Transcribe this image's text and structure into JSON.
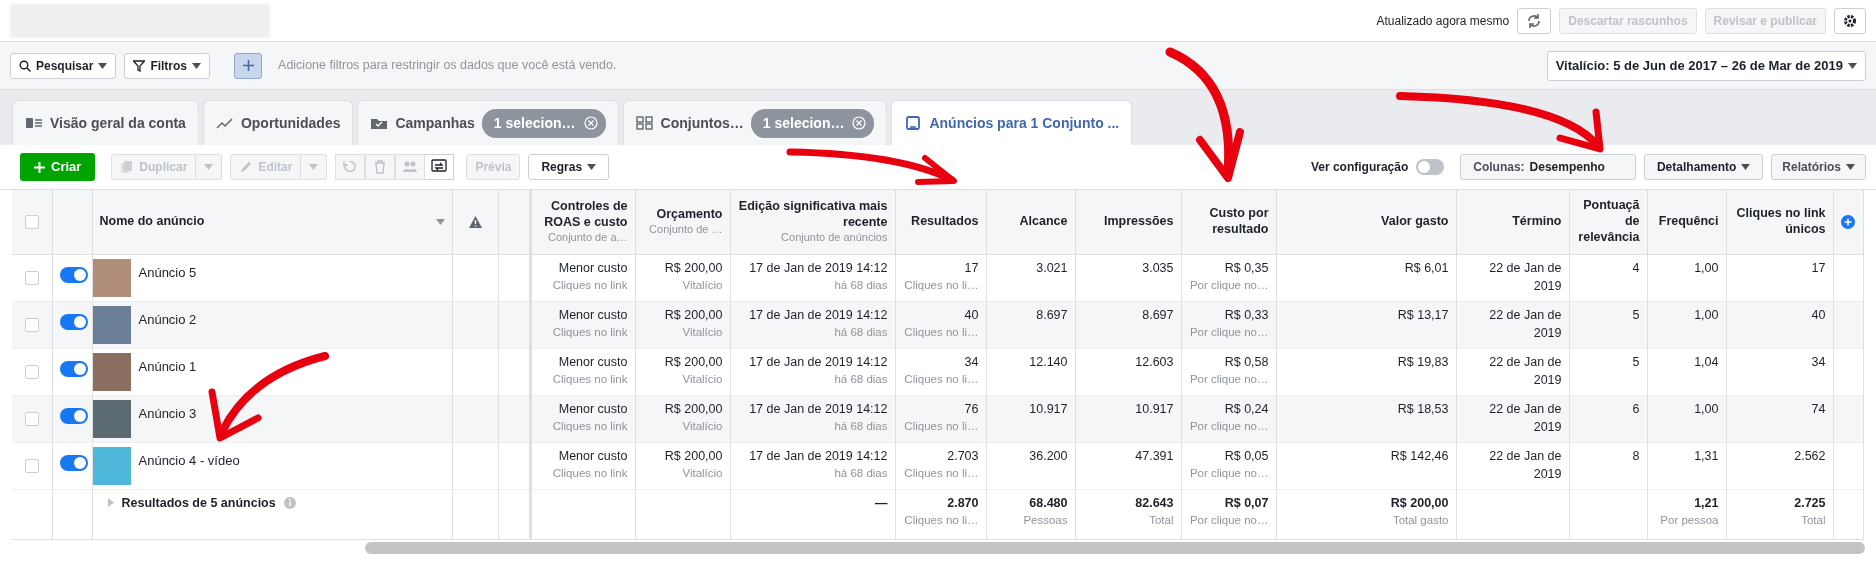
{
  "top_bar": {
    "status": "Atualizado agora mesmo",
    "buttons": [
      {
        "label": "Descartar rascunhos",
        "disabled": true
      },
      {
        "label": "Revisar e publicar",
        "disabled": true
      }
    ]
  },
  "filter_bar": {
    "search": "Pesquisar",
    "filters": "Filtros",
    "hint": "Adicione filtros para restringir os dados que você está vendo.",
    "date_range": "Vitalício: 5 de Jun de 2017 – 26 de Mar de 2019"
  },
  "tabs": [
    {
      "label": "Visão geral da conta",
      "selected": false
    },
    {
      "label": "Oportunidades",
      "selected": false
    },
    {
      "label": "Campanhas",
      "badge": "1 selecion…",
      "selected": false
    },
    {
      "label": "Conjuntos…",
      "badge": "1 selecion…",
      "selected": false
    },
    {
      "label": "Anúncios para 1 Conjunto ...",
      "selected": true
    }
  ],
  "toolbar": {
    "actions": [
      {
        "kind": "primary",
        "label": "Criar",
        "disabled": false
      },
      {
        "kind": "split",
        "label": "Duplicar",
        "disabled": true
      },
      {
        "kind": "split",
        "label": "Editar",
        "disabled": true
      },
      {
        "kind": "icon",
        "disabled": true
      },
      {
        "kind": "icon",
        "disabled": true
      },
      {
        "kind": "icon",
        "disabled": true
      },
      {
        "kind": "icon",
        "disabled": false
      },
      {
        "kind": "plain",
        "label": "Prévia",
        "disabled": true
      },
      {
        "kind": "dropdown",
        "label": "Regras",
        "disabled": false
      }
    ],
    "view_settings": {
      "label": "Ver configuração",
      "on": false
    },
    "columns_picker": {
      "label": "Colunas:",
      "value": "Desempenho"
    },
    "breakdown": "Detalhamento",
    "reports": "Relatórios"
  },
  "table": {
    "all_selected": false,
    "name_column": "Nome do anúncio",
    "columns": [
      {
        "label": "Controles de ROAS e custo",
        "sublabel": "Conjunto de a…"
      },
      {
        "label": "Orçamento",
        "sublabel": "Conjunto de …"
      },
      {
        "label": "Edição significativa mais recente",
        "sublabel": "Conjunto de anúncios"
      },
      {
        "label": "Resultados"
      },
      {
        "label": "Alcance"
      },
      {
        "label": "Impressões"
      },
      {
        "label": "Custo por resultado"
      },
      {
        "label": "Valor gasto"
      },
      {
        "label": "Término"
      },
      {
        "label": "Pontuaçã de relevância"
      },
      {
        "label": "Frequênci"
      },
      {
        "label": "Cliques no link únicos"
      }
    ],
    "rows": [
      {
        "selected": false,
        "on": true,
        "name": "Anúncio 5",
        "cells": [
          [
            "Menor custo",
            "Cliques no link"
          ],
          [
            "R$ 200,00",
            "Vitalício"
          ],
          [
            "17 de Jan de 2019 14:12",
            "há 68 dias"
          ],
          [
            "17",
            "Cliques no li…"
          ],
          [
            "3.021"
          ],
          [
            "3.035"
          ],
          [
            "R$ 0,35",
            "Por clique no…"
          ],
          [
            "R$ 6,01"
          ],
          [
            "22 de Jan de 2019"
          ],
          [
            "4"
          ],
          [
            "1,00"
          ],
          [
            "17"
          ]
        ]
      },
      {
        "selected": false,
        "on": true,
        "name": "Anúncio 2",
        "cells": [
          [
            "Menor custo",
            "Cliques no link"
          ],
          [
            "R$ 200,00",
            "Vitalício"
          ],
          [
            "17 de Jan de 2019 14:12",
            "há 68 dias"
          ],
          [
            "40",
            "Cliques no li…"
          ],
          [
            "8.697"
          ],
          [
            "8.697"
          ],
          [
            "R$ 0,33",
            "Por clique no…"
          ],
          [
            "R$ 13,17"
          ],
          [
            "22 de Jan de 2019"
          ],
          [
            "5"
          ],
          [
            "1,00"
          ],
          [
            "40"
          ]
        ]
      },
      {
        "selected": false,
        "on": true,
        "name": "Anúncio 1",
        "cells": [
          [
            "Menor custo",
            "Cliques no link"
          ],
          [
            "R$ 200,00",
            "Vitalício"
          ],
          [
            "17 de Jan de 2019 14:12",
            "há 68 dias"
          ],
          [
            "34",
            "Cliques no li…"
          ],
          [
            "12.140"
          ],
          [
            "12.603"
          ],
          [
            "R$ 0,58",
            "Por clique no…"
          ],
          [
            "R$ 19,83"
          ],
          [
            "22 de Jan de 2019"
          ],
          [
            "5"
          ],
          [
            "1,04"
          ],
          [
            "34"
          ]
        ]
      },
      {
        "selected": false,
        "on": true,
        "name": "Anúncio 3",
        "cells": [
          [
            "Menor custo",
            "Cliques no link"
          ],
          [
            "R$ 200,00",
            "Vitalício"
          ],
          [
            "17 de Jan de 2019 14:12",
            "há 68 dias"
          ],
          [
            "76",
            "Cliques no li…"
          ],
          [
            "10.917"
          ],
          [
            "10.917"
          ],
          [
            "R$ 0,24",
            "Por clique no…"
          ],
          [
            "R$ 18,53"
          ],
          [
            "22 de Jan de 2019"
          ],
          [
            "6"
          ],
          [
            "1,00"
          ],
          [
            "74"
          ]
        ]
      },
      {
        "selected": false,
        "on": true,
        "name": "Anúncio 4 - vídeo",
        "cells": [
          [
            "Menor custo",
            "Cliques no link"
          ],
          [
            "R$ 200,00",
            "Vitalício"
          ],
          [
            "17 de Jan de 2019 14:12",
            "há 68 dias"
          ],
          [
            "2.703",
            "Cliques no li…"
          ],
          [
            "36.200"
          ],
          [
            "47.391"
          ],
          [
            "R$ 0,05",
            "Por clique no…"
          ],
          [
            "R$ 142,46"
          ],
          [
            "22 de Jan de 2019"
          ],
          [
            "8"
          ],
          [
            "1,31"
          ],
          [
            "2.562"
          ]
        ]
      }
    ],
    "summary": {
      "label": "Resultados de 5 anúncios",
      "cells": [
        null,
        null,
        [
          "—"
        ],
        [
          "2.870",
          "Cliques no li…"
        ],
        [
          "68.480",
          "Pessoas"
        ],
        [
          "82.643",
          "Total"
        ],
        [
          "R$ 0,07",
          "Por clique no…"
        ],
        [
          "R$ 200,00",
          "Total gasto"
        ],
        null,
        null,
        [
          "1,21",
          "Por pessoa"
        ],
        [
          "2.725",
          "Total"
        ]
      ]
    }
  }
}
